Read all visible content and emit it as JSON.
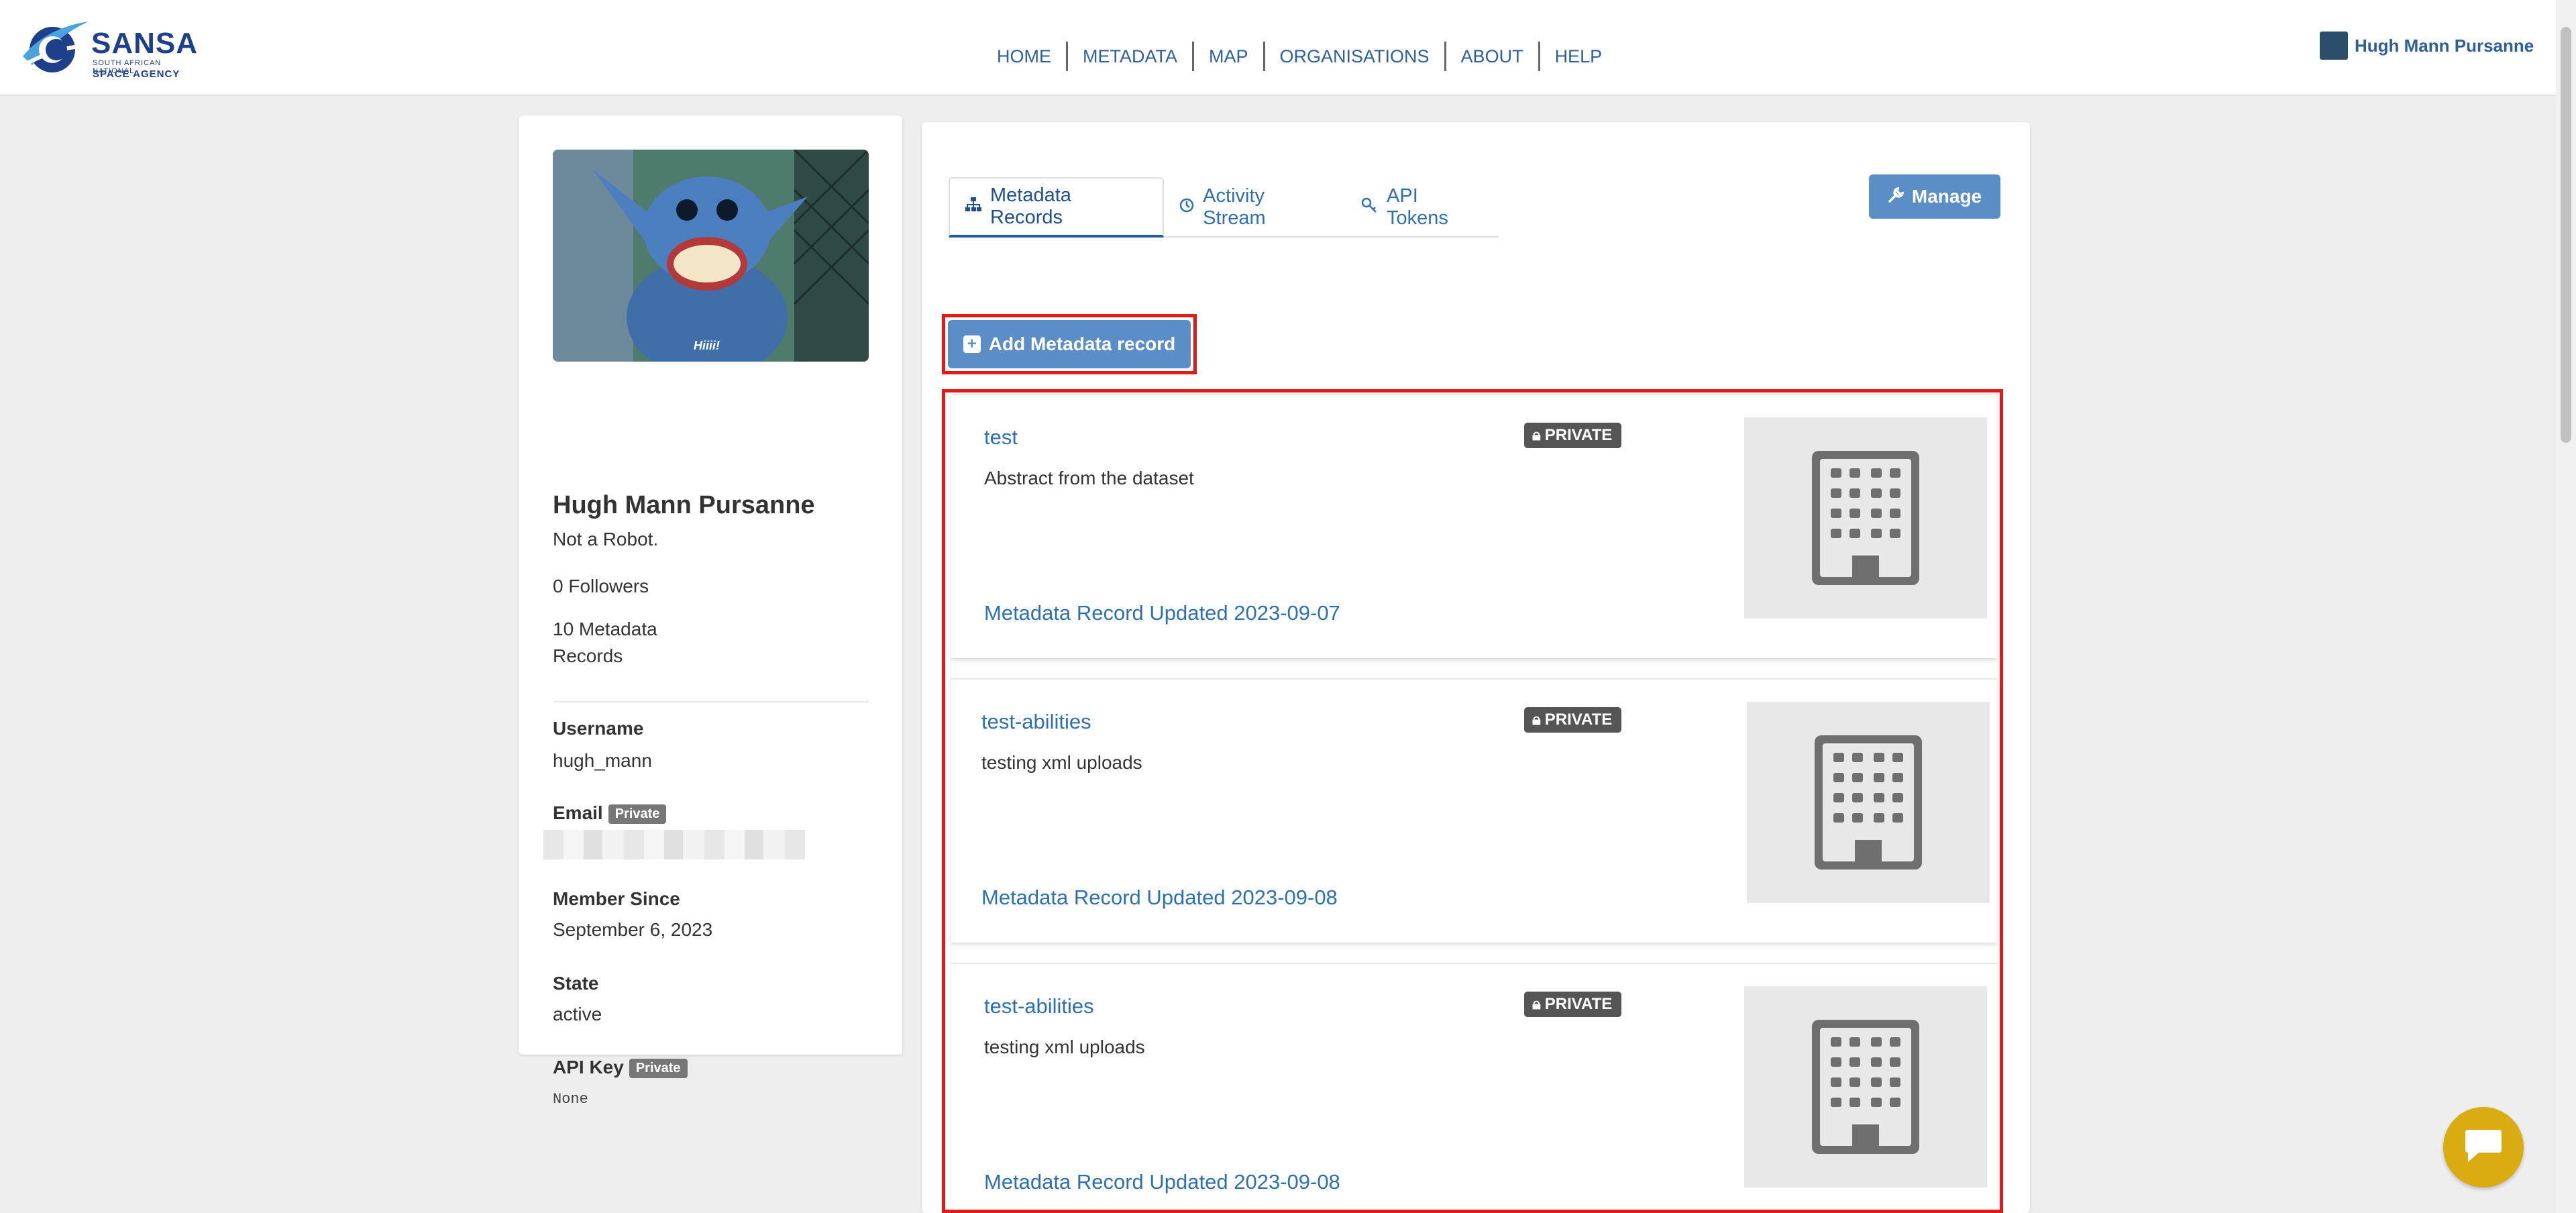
{
  "brand": {
    "name": "SANSA",
    "tagline_small": "SOUTH AFRICAN NATIONAL",
    "tagline": "SPACE AGENCY"
  },
  "nav": {
    "items": [
      {
        "label": "HOME"
      },
      {
        "label": "METADATA"
      },
      {
        "label": "MAP"
      },
      {
        "label": "ORGANISATIONS"
      },
      {
        "label": "ABOUT"
      },
      {
        "label": "HELP"
      }
    ]
  },
  "user": {
    "display_name": "Hugh Mann Pursanne"
  },
  "profile": {
    "image_caption": "Hiiii!",
    "name": "Hugh Mann Pursanne",
    "about": "Not a Robot.",
    "followers": "0 Followers",
    "records": "10 Metadata Records",
    "username_label": "Username",
    "username": "hugh_mann",
    "email_label": "Email",
    "private_badge": "Private",
    "member_since_label": "Member Since",
    "member_since": "September 6, 2023",
    "state_label": "State",
    "state": "active",
    "api_key_label": "API Key",
    "api_key": "None"
  },
  "tabs": [
    {
      "label": "Metadata Records",
      "icon": "sitemap-icon",
      "active": true
    },
    {
      "label": "Activity Stream",
      "icon": "clock-icon",
      "active": false
    },
    {
      "label": "API Tokens",
      "icon": "key-icon",
      "active": false
    }
  ],
  "manage_label": "Manage",
  "add_record_label": "Add Metadata record",
  "records": [
    {
      "title": "test",
      "notes": "Abstract from the dataset",
      "badge": "PRIVATE",
      "updated": "Metadata Record Updated 2023-09-07"
    },
    {
      "title": "test-abilities",
      "notes": "testing xml uploads",
      "badge": "PRIVATE",
      "updated": "Metadata Record Updated 2023-09-08"
    },
    {
      "title": "test-abilities",
      "notes": "testing xml uploads",
      "badge": "PRIVATE",
      "updated": "Metadata Record Updated 2023-09-08"
    }
  ],
  "colors": {
    "accent": "#5b8ec7",
    "link": "#2d6fb0",
    "highlight": "#e01919",
    "chat": "#dbab12"
  }
}
